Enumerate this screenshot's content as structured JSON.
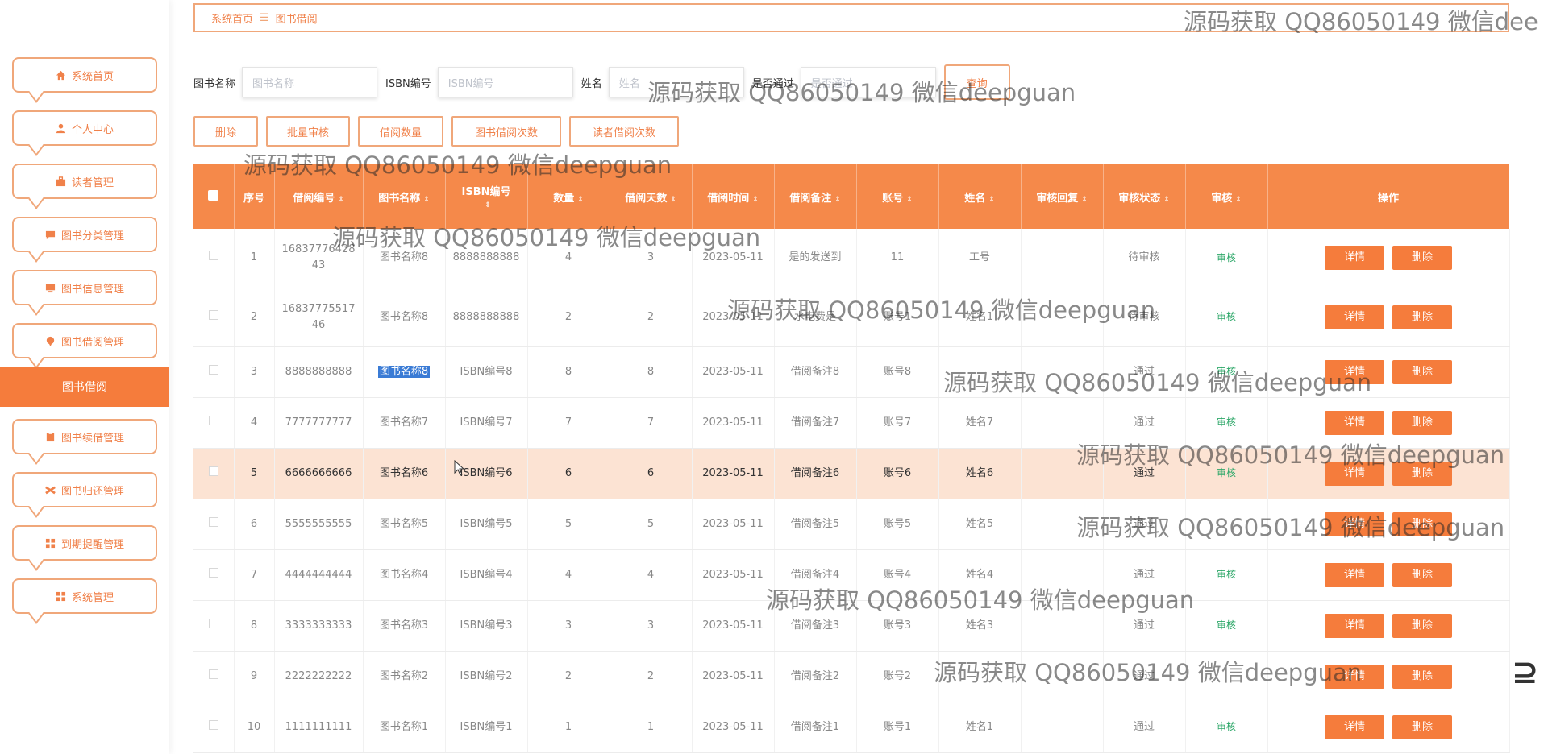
{
  "sidebar": {
    "items": [
      {
        "label": "系统首页",
        "icon": "home-icon"
      },
      {
        "label": "个人中心",
        "icon": "user-icon"
      },
      {
        "label": "读者管理",
        "icon": "briefcase-icon"
      },
      {
        "label": "图书分类管理",
        "icon": "chat-icon"
      },
      {
        "label": "图书信息管理",
        "icon": "monitor-icon"
      },
      {
        "label": "图书借阅管理",
        "icon": "pin-icon"
      },
      {
        "label": "图书续借管理",
        "icon": "clipboard-icon"
      },
      {
        "label": "图书归还管理",
        "icon": "ticket-icon"
      },
      {
        "label": "到期提醒管理",
        "icon": "grid-icon"
      },
      {
        "label": "系统管理",
        "icon": "grid-icon"
      }
    ],
    "active_sub": "图书借阅"
  },
  "breadcrumb": {
    "home": "系统首页",
    "sep": "☰",
    "current": "图书借阅"
  },
  "search": {
    "book_name_label": "图书名称",
    "book_name_placeholder": "图书名称",
    "isbn_label": "ISBN编号",
    "isbn_placeholder": "ISBN编号",
    "name_label": "姓名",
    "name_placeholder": "姓名",
    "pass_label": "是否通过",
    "pass_placeholder": "是否通过",
    "query_label": "查询"
  },
  "actions": [
    "删除",
    "批量审核",
    "借阅数量",
    "图书借阅次数",
    "读者借阅次数"
  ],
  "table": {
    "headers": [
      "序号",
      "借阅编号",
      "图书名称",
      "ISBN编号",
      "数量",
      "借阅天数",
      "借阅时间",
      "借阅备注",
      "账号",
      "姓名",
      "审核回复",
      "审核状态",
      "审核",
      "操作"
    ],
    "rows": [
      {
        "no": "1",
        "code": "1683777642843",
        "book": "图书名称8",
        "isbn": "8888888888",
        "qty": "4",
        "days": "3",
        "date": "2023-05-11",
        "note": "是的发送到",
        "account": "11",
        "name": "工号",
        "reply": "",
        "status": "待审核",
        "audit": "审核"
      },
      {
        "no": "2",
        "code": "1683777551746",
        "book": "图书名称8",
        "isbn": "8888888888",
        "qty": "2",
        "days": "2",
        "date": "2023-05-11",
        "note": "水电费是",
        "account": "账号1",
        "name": "姓名1",
        "reply": "",
        "status": "待审核",
        "audit": "审核"
      },
      {
        "no": "3",
        "code": "8888888888",
        "book": "图书名称8",
        "isbn": "ISBN编号8",
        "qty": "8",
        "days": "8",
        "date": "2023-05-11",
        "note": "借阅备注8",
        "account": "账号8",
        "name": "",
        "reply": "",
        "status": "通过",
        "audit": "审核"
      },
      {
        "no": "4",
        "code": "7777777777",
        "book": "图书名称7",
        "isbn": "ISBN编号7",
        "qty": "7",
        "days": "7",
        "date": "2023-05-11",
        "note": "借阅备注7",
        "account": "账号7",
        "name": "姓名7",
        "reply": "",
        "status": "通过",
        "audit": "审核"
      },
      {
        "no": "5",
        "code": "6666666666",
        "book": "图书名称6",
        "isbn": "ISBN编号6",
        "qty": "6",
        "days": "6",
        "date": "2023-05-11",
        "note": "借阅备注6",
        "account": "账号6",
        "name": "姓名6",
        "reply": "",
        "status": "通过",
        "audit": "审核"
      },
      {
        "no": "6",
        "code": "5555555555",
        "book": "图书名称5",
        "isbn": "ISBN编号5",
        "qty": "5",
        "days": "5",
        "date": "2023-05-11",
        "note": "借阅备注5",
        "account": "账号5",
        "name": "姓名5",
        "reply": "",
        "status": "通过",
        "audit": ""
      },
      {
        "no": "7",
        "code": "4444444444",
        "book": "图书名称4",
        "isbn": "ISBN编号4",
        "qty": "4",
        "days": "4",
        "date": "2023-05-11",
        "note": "借阅备注4",
        "account": "账号4",
        "name": "姓名4",
        "reply": "",
        "status": "通过",
        "audit": "审核"
      },
      {
        "no": "8",
        "code": "3333333333",
        "book": "图书名称3",
        "isbn": "ISBN编号3",
        "qty": "3",
        "days": "3",
        "date": "2023-05-11",
        "note": "借阅备注3",
        "account": "账号3",
        "name": "姓名3",
        "reply": "",
        "status": "通过",
        "audit": "审核"
      },
      {
        "no": "9",
        "code": "2222222222",
        "book": "图书名称2",
        "isbn": "ISBN编号2",
        "qty": "2",
        "days": "2",
        "date": "2023-05-11",
        "note": "借阅备注2",
        "account": "账号2",
        "name": "",
        "reply": "",
        "status": "通过",
        "audit": ""
      },
      {
        "no": "10",
        "code": "1111111111",
        "book": "图书名称1",
        "isbn": "ISBN编号1",
        "qty": "1",
        "days": "1",
        "date": "2023-05-11",
        "note": "借阅备注1",
        "account": "账号1",
        "name": "姓名1",
        "reply": "",
        "status": "通过",
        "audit": "审核"
      }
    ],
    "detail_label": "详情",
    "delete_label": "删除"
  },
  "watermark": "源码获取 QQ86050149 微信deepguan",
  "watermark_cut": "源码获取 QQ86050149 微信dee",
  "colors": {
    "accent": "#f57c3c",
    "border": "#f0a77a",
    "header": "#f5894a",
    "highlight": "#fce3d3",
    "audit": "#2fa86a"
  }
}
